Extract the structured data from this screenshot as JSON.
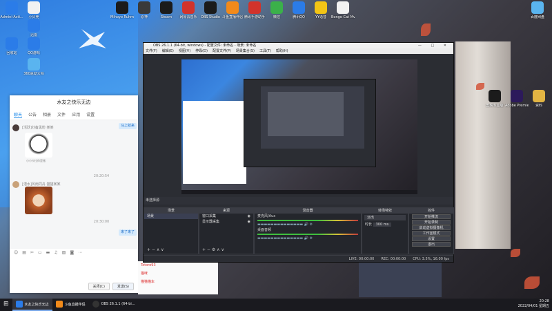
{
  "desktop_icons": [
    {
      "label": "Admini-Acti...",
      "color": "blue",
      "x": 0
    },
    {
      "label": "小贝壳",
      "color": "white",
      "x": 0
    },
    {
      "label": "迅雷",
      "color": "blue",
      "x": 0
    },
    {
      "label": "QQ游戏",
      "color": "blue",
      "x": 0
    },
    {
      "label": "回收站",
      "color": "blue",
      "x": 0
    },
    {
      "label": "360驱动大师",
      "color": "lightblue",
      "x": 0
    },
    {
      "label": "Mihoyo Ruhm",
      "color": "dark",
      "x": 0
    },
    {
      "label": "原神",
      "color": "grey",
      "x": 0
    },
    {
      "label": "Steam",
      "color": "dark",
      "x": 0
    },
    {
      "label": "网易云音乐",
      "color": "red",
      "x": 0
    },
    {
      "label": "OBS Studio",
      "color": "dark",
      "x": 0
    },
    {
      "label": "斗鱼直播伴侣",
      "color": "orange",
      "x": 0
    },
    {
      "label": "腾讯手游助手",
      "color": "red",
      "x": 0
    },
    {
      "label": "微信",
      "color": "green",
      "x": 0
    },
    {
      "label": "腾讯QQ",
      "color": "blue",
      "x": 0
    },
    {
      "label": "YY语音",
      "color": "yellow",
      "x": 0
    },
    {
      "label": "Bongo Cat Mver",
      "color": "white",
      "x": 0
    },
    {
      "label": "百度网盘",
      "color": "lightblue",
      "x": 0
    },
    {
      "label": "剪映专业版",
      "color": "dark",
      "x": 0
    },
    {
      "label": "Adobe Premiere",
      "color": "purple",
      "x": 0
    },
    {
      "label": "资料",
      "color": "folder",
      "x": 0
    }
  ],
  "chat": {
    "title": "水友之快乐无边",
    "tabs": [
      "聊天",
      "公告",
      "相册",
      "文件",
      "应用",
      "设置"
    ],
    "msg1_meta": "[活跃]刘备黑粉 某某",
    "sticker1_caption": "小小卡拉你是猪",
    "time1": "20:20:54",
    "msg2_meta": "[潜水]风雨同舟 猫猫某某",
    "time2": "20:30:00",
    "right_bubble1": "马上就来",
    "right_bubble2": "来了来了",
    "close_btn": "关闭(C)",
    "send_btn": "发送(S)"
  },
  "group_side": {
    "items": [
      "Totoro93",
      "猫咪",
      "猫猫猫车"
    ]
  },
  "obs": {
    "title": "OBS 26.1.1 (64-bit, windows) - 配置文件: 未命名 - 场景: 未命名",
    "menu": [
      "文件(F)",
      "编辑(E)",
      "视图(V)",
      "停靠(D)",
      "配置文件(P)",
      "场景集合(S)",
      "工具(T)",
      "帮助(H)"
    ],
    "scene_ctl": "未选择源",
    "docks": {
      "scenes": {
        "header": "场景",
        "items": [
          "场景"
        ]
      },
      "sources": {
        "header": "来源",
        "items": [
          "窗口采集",
          "显示器采集"
        ]
      },
      "mixer": {
        "header": "混音器",
        "items": [
          "麦克风/Aux",
          "桌面音频"
        ],
        "level": "0.0 dB"
      },
      "transitions": {
        "header": "转场特效",
        "fade": "淡出",
        "duration_label": "时长",
        "duration": "300 ms"
      },
      "controls": {
        "header": "控件",
        "buttons": [
          "开始推流",
          "开始录制",
          "启动虚拟摄像机",
          "工作室模式",
          "设置",
          "退出"
        ]
      }
    },
    "status": {
      "live": "LIVE: 00:00:00",
      "rec": "REC: 00:00:00",
      "cpu": "CPU: 3.5%, 16.00 fps"
    }
  },
  "taskbar": {
    "items": [
      "水友之快乐无边",
      "斗鱼直播伴侣",
      "OBS 26.1.1 (64-bi..."
    ],
    "time": "20:28",
    "date": "2022/04/01 星期五"
  }
}
